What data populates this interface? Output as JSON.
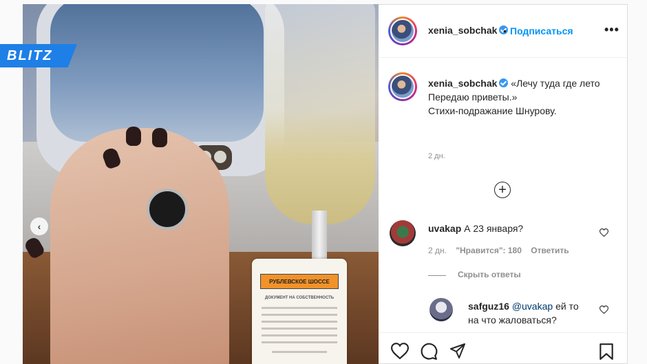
{
  "watermark": "BLITZ",
  "photo": {
    "card_title": "РУБЛЕВСКОЕ ШОССЕ",
    "card_subtitle": "ДОКУМЕНТ НА СОБСТВЕННОСТЬ"
  },
  "post": {
    "username": "xenia_sobchak",
    "separator": "•",
    "follow_label": "Подписаться",
    "more_label": "•••",
    "caption_line1": "«Лечу туда где лето",
    "caption_line2": "Передаю приветы.»",
    "caption_line3": "Стихи-подражание Шнурову.",
    "time": "2 дн.",
    "load_more_label": "+"
  },
  "comments": [
    {
      "username": "uvakap",
      "text": "А 23 января?",
      "time": "2 дн.",
      "likes": "\"Нравится\": 180",
      "reply_label": "Ответить"
    }
  ],
  "hide_replies_label": "Скрыть ответы",
  "replies": [
    {
      "username": "safguz16",
      "mention": "@uvakap",
      "text_line1": "ей то",
      "text_line2": "на что жаловаться?"
    }
  ],
  "colors": {
    "follow": "#0095f6",
    "verified": "#3897f0",
    "watermark_bg": "#1e7fe6"
  }
}
